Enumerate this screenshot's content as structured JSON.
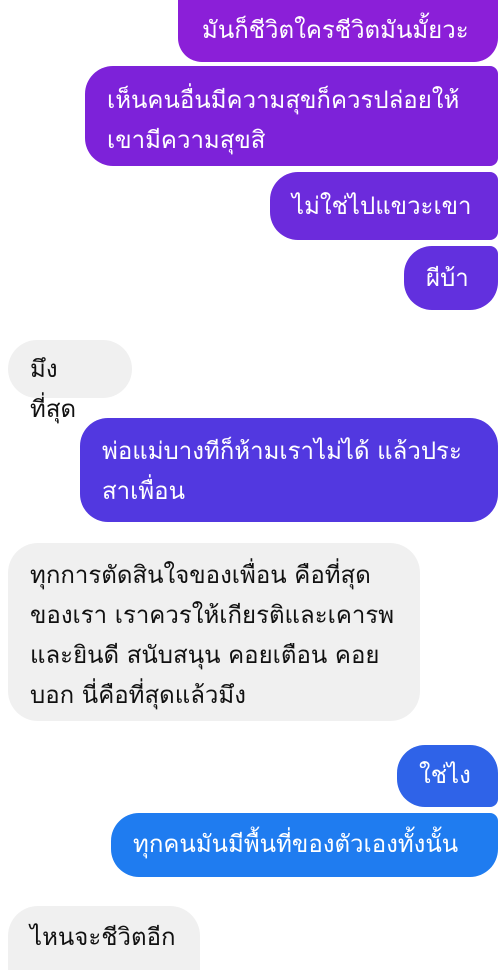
{
  "messages": [
    {
      "id": "b1",
      "direction": "outgoing",
      "text": "มันก็ชีวิตใครชีวิตมันมั้ยวะ"
    },
    {
      "id": "b2",
      "direction": "outgoing",
      "text": "เห็นคนอื่นมีความสุขก็ควรปล่อยให้\nเขามีความสุขสิ"
    },
    {
      "id": "b3",
      "direction": "outgoing",
      "text": "ไม่ใช่ไปแขวะเขา"
    },
    {
      "id": "b4",
      "direction": "outgoing",
      "text": "ผีบ้า"
    },
    {
      "id": "b5",
      "direction": "incoming",
      "text": "มึง ที่สุด"
    },
    {
      "id": "b6",
      "direction": "outgoing",
      "text": "พ่อแม่บางทีก็ห้ามเราไม่ได้ แล้วประ\nสาเพื่อน"
    },
    {
      "id": "b7",
      "direction": "incoming",
      "text": "ทุกการตัดสินใจของเพื่อน คือที่สุด\nของเรา เราควรให้เกียรติและเคารพ\nและยินดี สนับสนุน คอยเตือน คอย\nบอก นี่คือที่สุดแล้วมึง"
    },
    {
      "id": "b8",
      "direction": "outgoing",
      "text": "ใช่ไง"
    },
    {
      "id": "b9",
      "direction": "outgoing",
      "text": "ทุกคนมันมีพื้นที่ของตัวเองทั้งนั้น"
    },
    {
      "id": "b10",
      "direction": "incoming",
      "text": "ไหนจะชีวิตอีก"
    }
  ],
  "colors": {
    "outgoing_top": "#8b1fd8",
    "outgoing_bottom": "#1f7cf0",
    "incoming_bg": "#f0f0f0",
    "incoming_text": "#111111"
  }
}
